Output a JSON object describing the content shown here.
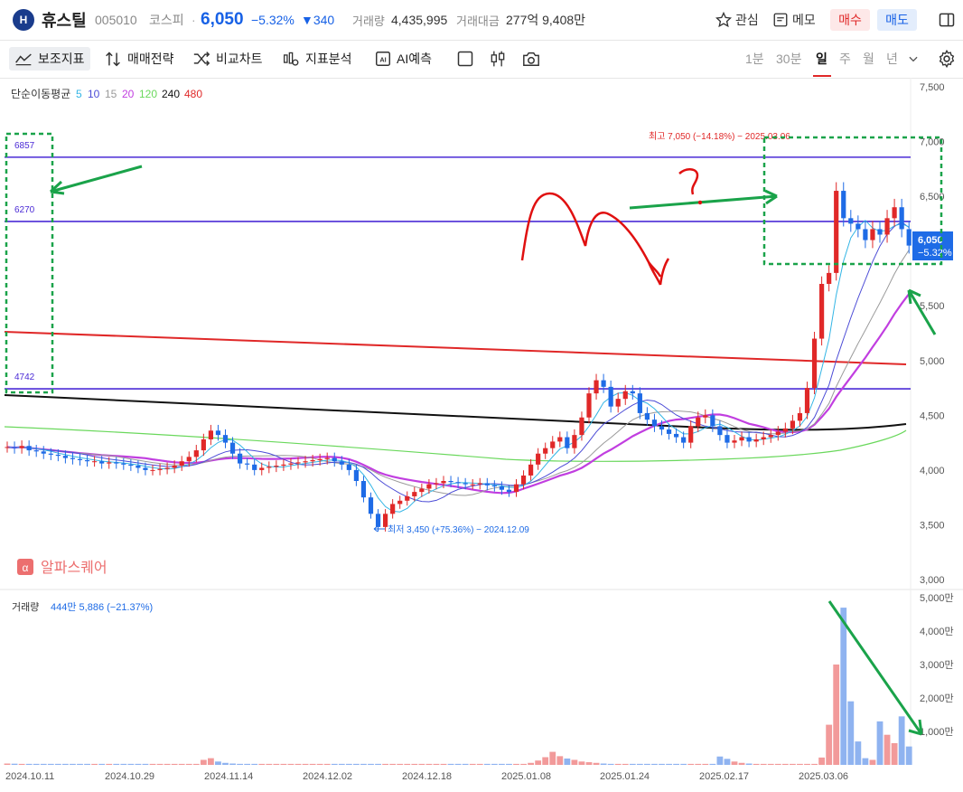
{
  "header": {
    "logo_text": "H",
    "name": "휴스틸",
    "code": "005010",
    "market": "코스피",
    "separator": "·",
    "price": "6,050",
    "change_pct": "−5.32%",
    "change_abs": "▼340",
    "volume_label": "거래량",
    "volume_value": "4,435,995",
    "amount_label": "거래대금",
    "amount_value": "277억 9,408만",
    "watch_label": "관심",
    "memo_label": "메모",
    "buy_label": "매수",
    "sell_label": "매도"
  },
  "toolbar": {
    "indicators": "보조지표",
    "strategy": "매매전략",
    "compare": "비교차트",
    "analysis": "지표분석",
    "ai": "AI예측",
    "periods": [
      "1분",
      "30분",
      "일",
      "주",
      "월",
      "년"
    ],
    "active_period": "일"
  },
  "colors": {
    "up": "#e02828",
    "down": "#1e6be6",
    "ma5": "#33b5e5",
    "ma10": "#4b4bd6",
    "ma15": "#9a9a9a",
    "ma20": "#c13ee0",
    "ma120": "#6ad85c",
    "ma240": "#111111",
    "ma480": "#e02828",
    "hline": "#4b2bd6",
    "annot_green": "#1aa34a",
    "annot_red": "#e01010"
  },
  "ma_legend": {
    "title": "단순이동평균",
    "items": [
      "5",
      "10",
      "15",
      "20",
      "120",
      "240",
      "480"
    ]
  },
  "chart_data": {
    "type": "candlestick",
    "price_axis": {
      "ticks": [
        "7,500",
        "7,000",
        "6,500",
        "6,000",
        "5,500",
        "5,000",
        "4,500",
        "4,000",
        "3,500",
        "3,000"
      ],
      "ylim": [
        3000,
        7500
      ]
    },
    "volume_axis": {
      "ticks": [
        "5,000만",
        "4,000만",
        "3,000만",
        "2,000만",
        "1,000만"
      ],
      "ylim": [
        0,
        5000
      ]
    },
    "x_labels": [
      "2024.10.11",
      "2024.10.29",
      "2024.11.14",
      "2024.12.02",
      "2024.12.18",
      "2025.01.08",
      "2025.01.24",
      "2025.02.17",
      "2025.03.06"
    ],
    "horizontal_lines": [
      {
        "label": "6857",
        "value": 6857
      },
      {
        "label": "6270",
        "value": 6270
      },
      {
        "label": "4742",
        "value": 4742
      }
    ],
    "annotation_high": "최고 7,050 (−14.18%) − 2025.03.06",
    "annotation_low": "최저 3,450 (+75.36%) − 2024.12.09",
    "last_price_label": "6,050",
    "last_change_label": "−5.32%",
    "watermark": "알파스퀘어",
    "volume_title": "거래량",
    "volume_value": "444만 5,886 (−21.37%)",
    "closes": [
      4210,
      4200,
      4220,
      4180,
      4170,
      4150,
      4140,
      4130,
      4110,
      4100,
      4090,
      4080,
      4080,
      4060,
      4070,
      4060,
      4050,
      4040,
      4020,
      4000,
      4000,
      4010,
      4020,
      4040,
      4080,
      4120,
      4180,
      4280,
      4360,
      4320,
      4250,
      4150,
      4060,
      4050,
      4000,
      4020,
      4030,
      4040,
      4050,
      4060,
      4070,
      4080,
      4090,
      4100,
      4110,
      4080,
      4050,
      4000,
      3900,
      3750,
      3600,
      3480,
      3600,
      3690,
      3720,
      3760,
      3800,
      3830,
      3870,
      3880,
      3900,
      3890,
      3880,
      3870,
      3870,
      3880,
      3860,
      3850,
      3820,
      3800,
      3870,
      3950,
      4050,
      4150,
      4200,
      4260,
      4300,
      4200,
      4320,
      4480,
      4700,
      4820,
      4760,
      4580,
      4650,
      4720,
      4700,
      4520,
      4460,
      4400,
      4370,
      4330,
      4300,
      4250,
      4400,
      4480,
      4500,
      4400,
      4320,
      4250,
      4270,
      4300,
      4260,
      4280,
      4300,
      4320,
      4350,
      4380,
      4450,
      4520,
      4750,
      5200,
      5700,
      5800,
      6550,
      6300,
      6250,
      6200,
      6100,
      6200,
      6150,
      6300,
      6400,
      6200,
      6050
    ],
    "volumes": [
      40,
      35,
      30,
      30,
      30,
      30,
      30,
      30,
      30,
      30,
      30,
      30,
      30,
      30,
      30,
      30,
      30,
      30,
      30,
      30,
      30,
      30,
      30,
      30,
      30,
      30,
      30,
      150,
      200,
      100,
      60,
      40,
      30,
      30,
      30,
      30,
      30,
      30,
      30,
      30,
      30,
      30,
      30,
      30,
      30,
      30,
      30,
      30,
      30,
      30,
      30,
      30,
      30,
      30,
      30,
      30,
      30,
      30,
      30,
      30,
      30,
      30,
      30,
      30,
      30,
      30,
      30,
      30,
      30,
      30,
      30,
      30,
      60,
      130,
      230,
      390,
      260,
      190,
      150,
      100,
      80,
      60,
      40,
      30,
      30,
      30,
      30,
      30,
      30,
      30,
      30,
      30,
      30,
      30,
      30,
      30,
      30,
      30,
      250,
      180,
      100,
      60,
      40,
      30,
      30,
      30,
      30,
      30,
      30,
      30,
      30,
      30,
      220,
      1200,
      3000,
      4700,
      1900,
      700,
      200,
      150,
      1300,
      900,
      650,
      1450,
      550,
      450
    ]
  }
}
